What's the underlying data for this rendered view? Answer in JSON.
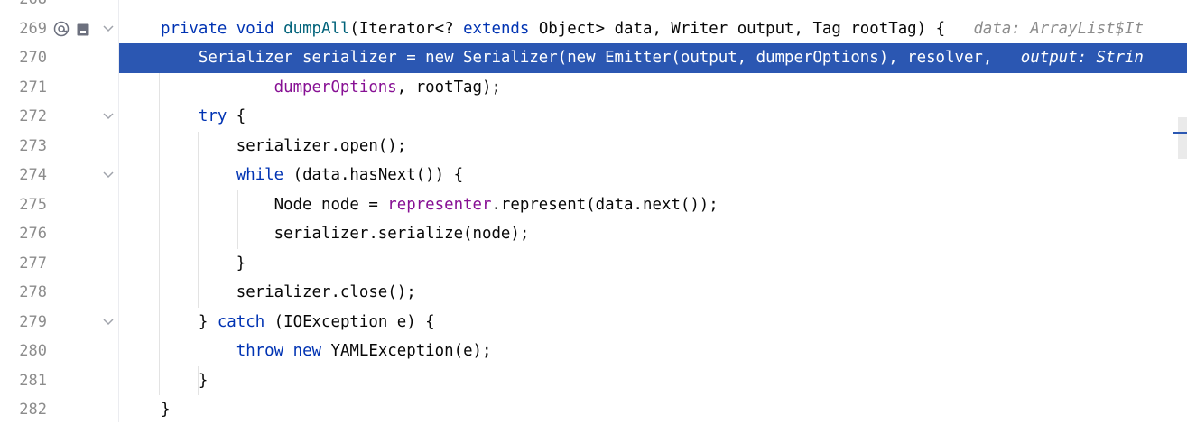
{
  "editor": {
    "top_partial_line": "268",
    "lines": [
      {
        "num": "269",
        "has_fold": true,
        "has_icons": true,
        "tokens": [
          {
            "t": "private ",
            "c": "kw"
          },
          {
            "t": "void ",
            "c": "kw"
          },
          {
            "t": "dumpAll",
            "c": "fn"
          },
          {
            "t": "(Iterator<? ",
            "c": ""
          },
          {
            "t": "extends ",
            "c": "kw"
          },
          {
            "t": "Object> data, Writer output, Tag rootTag) {",
            "c": ""
          },
          {
            "t": "   data: ArrayList$It",
            "c": "hint"
          }
        ]
      },
      {
        "num": "270",
        "has_fold": false,
        "highlight": true,
        "tokens": [
          {
            "t": "    Serializer serializer = new Serializer(new Emitter(output, dumperOptions), resolver,",
            "c": ""
          },
          {
            "t": "   output: Strin",
            "c": "hint"
          }
        ]
      },
      {
        "num": "271",
        "has_fold": false,
        "tokens": [
          {
            "t": "            ",
            "c": ""
          },
          {
            "t": "dumperOptions",
            "c": "field"
          },
          {
            "t": ", rootTag);",
            "c": ""
          }
        ]
      },
      {
        "num": "272",
        "has_fold": true,
        "tokens": [
          {
            "t": "    ",
            "c": ""
          },
          {
            "t": "try",
            "c": "kw"
          },
          {
            "t": " {",
            "c": ""
          }
        ]
      },
      {
        "num": "273",
        "has_fold": false,
        "tokens": [
          {
            "t": "        serializer.open();",
            "c": ""
          }
        ]
      },
      {
        "num": "274",
        "has_fold": true,
        "tokens": [
          {
            "t": "        ",
            "c": ""
          },
          {
            "t": "while",
            "c": "kw"
          },
          {
            "t": " (data.hasNext()) {",
            "c": ""
          }
        ]
      },
      {
        "num": "275",
        "has_fold": false,
        "tokens": [
          {
            "t": "            Node node = ",
            "c": ""
          },
          {
            "t": "representer",
            "c": "field"
          },
          {
            "t": ".represent(data.next());",
            "c": ""
          }
        ]
      },
      {
        "num": "276",
        "has_fold": false,
        "tokens": [
          {
            "t": "            serializer.serialize(node);",
            "c": ""
          }
        ]
      },
      {
        "num": "277",
        "has_fold": false,
        "tokens": [
          {
            "t": "        }",
            "c": ""
          }
        ]
      },
      {
        "num": "278",
        "has_fold": false,
        "tokens": [
          {
            "t": "        serializer.close();",
            "c": ""
          }
        ]
      },
      {
        "num": "279",
        "has_fold": true,
        "tokens": [
          {
            "t": "    } ",
            "c": ""
          },
          {
            "t": "catch",
            "c": "kw"
          },
          {
            "t": " (IOException e) {",
            "c": ""
          }
        ]
      },
      {
        "num": "280",
        "has_fold": false,
        "tokens": [
          {
            "t": "        ",
            "c": ""
          },
          {
            "t": "throw ",
            "c": "kw"
          },
          {
            "t": "new ",
            "c": "kw"
          },
          {
            "t": "YAMLException(e);",
            "c": ""
          }
        ]
      },
      {
        "num": "281",
        "has_fold": false,
        "tokens": [
          {
            "t": "    }",
            "c": ""
          }
        ]
      },
      {
        "num": "282",
        "has_fold": false,
        "tokens": [
          {
            "t": "}",
            "c": ""
          }
        ]
      }
    ]
  },
  "colors": {
    "selection": "#2b57b2",
    "keyword": "#0033b3",
    "method": "#00627a",
    "field": "#871094",
    "hint": "#8c8c8c"
  },
  "icons": [
    "override-annotation-icon",
    "bookmark-icon",
    "fold-chevron-icon"
  ]
}
